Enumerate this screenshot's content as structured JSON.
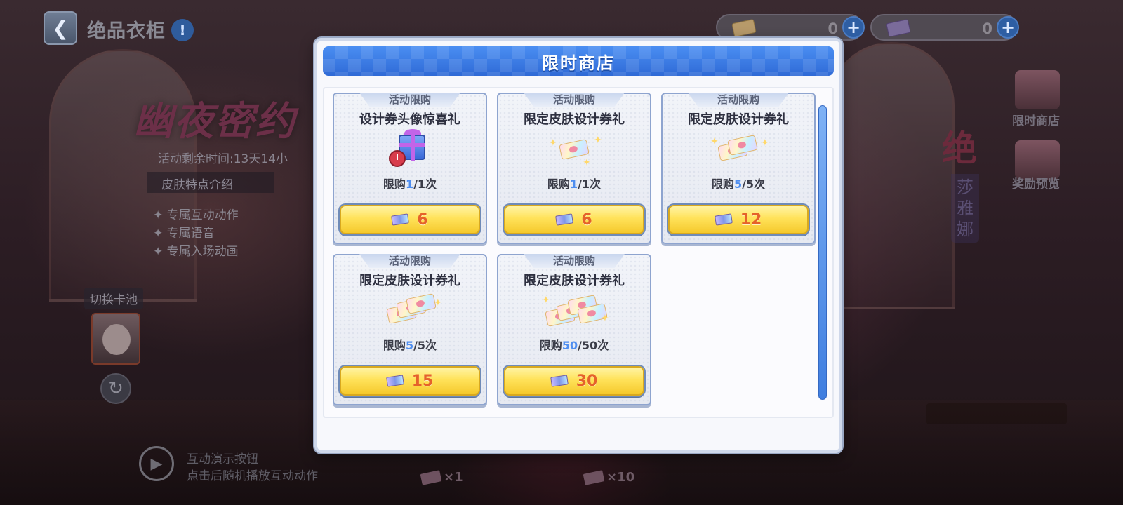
{
  "header": {
    "back_icon": "chevron-left-icon",
    "title": "绝品衣柜",
    "info_icon": "info-icon",
    "info_glyph": "!"
  },
  "currencies": [
    {
      "icon": "skin-ticket-icon",
      "value": "0",
      "plus": "+"
    },
    {
      "icon": "design-ticket-icon",
      "value": "0",
      "plus": "+"
    }
  ],
  "event": {
    "title": "幽夜密约",
    "time_remaining": "活动剩余时间:13天14小",
    "feature_heading": "皮肤特点介绍",
    "features": [
      "✦ 专属互动动作",
      "✦ 专属语音",
      "✦ 专属入场动画"
    ],
    "switch_pool": "切换卡池",
    "demo_line1": "互动演示按钮",
    "demo_line2": "点击后随机播放互动动作",
    "draw_once": "×1",
    "draw_ten": "×10"
  },
  "side": {
    "shop_label": "限时商店",
    "preview_label": "奖励预览",
    "badge": "绝",
    "character_name": "莎雅娜"
  },
  "modal": {
    "title": "限时商店",
    "items": [
      {
        "tag": "活动限购",
        "name": "设计券头像惊喜礼",
        "icon": "gift-box-icon",
        "limit_prefix": "限购",
        "limit_current": "1",
        "limit_total": "/1次",
        "price": "6"
      },
      {
        "tag": "活动限购",
        "name": "限定皮肤设计券礼",
        "icon": "ticket-icon",
        "limit_prefix": "限购",
        "limit_current": "1",
        "limit_total": "/1次",
        "price": "6"
      },
      {
        "tag": "活动限购",
        "name": "限定皮肤设计券礼",
        "icon": "tickets-stack-icon",
        "limit_prefix": "限购",
        "limit_current": "5",
        "limit_total": "/5次",
        "price": "12"
      },
      {
        "tag": "活动限购",
        "name": "限定皮肤设计券礼",
        "icon": "tickets-stack-icon",
        "limit_prefix": "限购",
        "limit_current": "5",
        "limit_total": "/5次",
        "price": "15"
      },
      {
        "tag": "活动限购",
        "name": "限定皮肤设计券礼",
        "icon": "tickets-pile-icon",
        "limit_prefix": "限购",
        "limit_current": "50",
        "limit_total": "/50次",
        "price": "30"
      }
    ]
  },
  "colors": {
    "header_blue": "#2f6ad6",
    "price_orange": "#e5622a",
    "limit_blue": "#4f8ef0",
    "button_yellow": "#ffe25a"
  }
}
